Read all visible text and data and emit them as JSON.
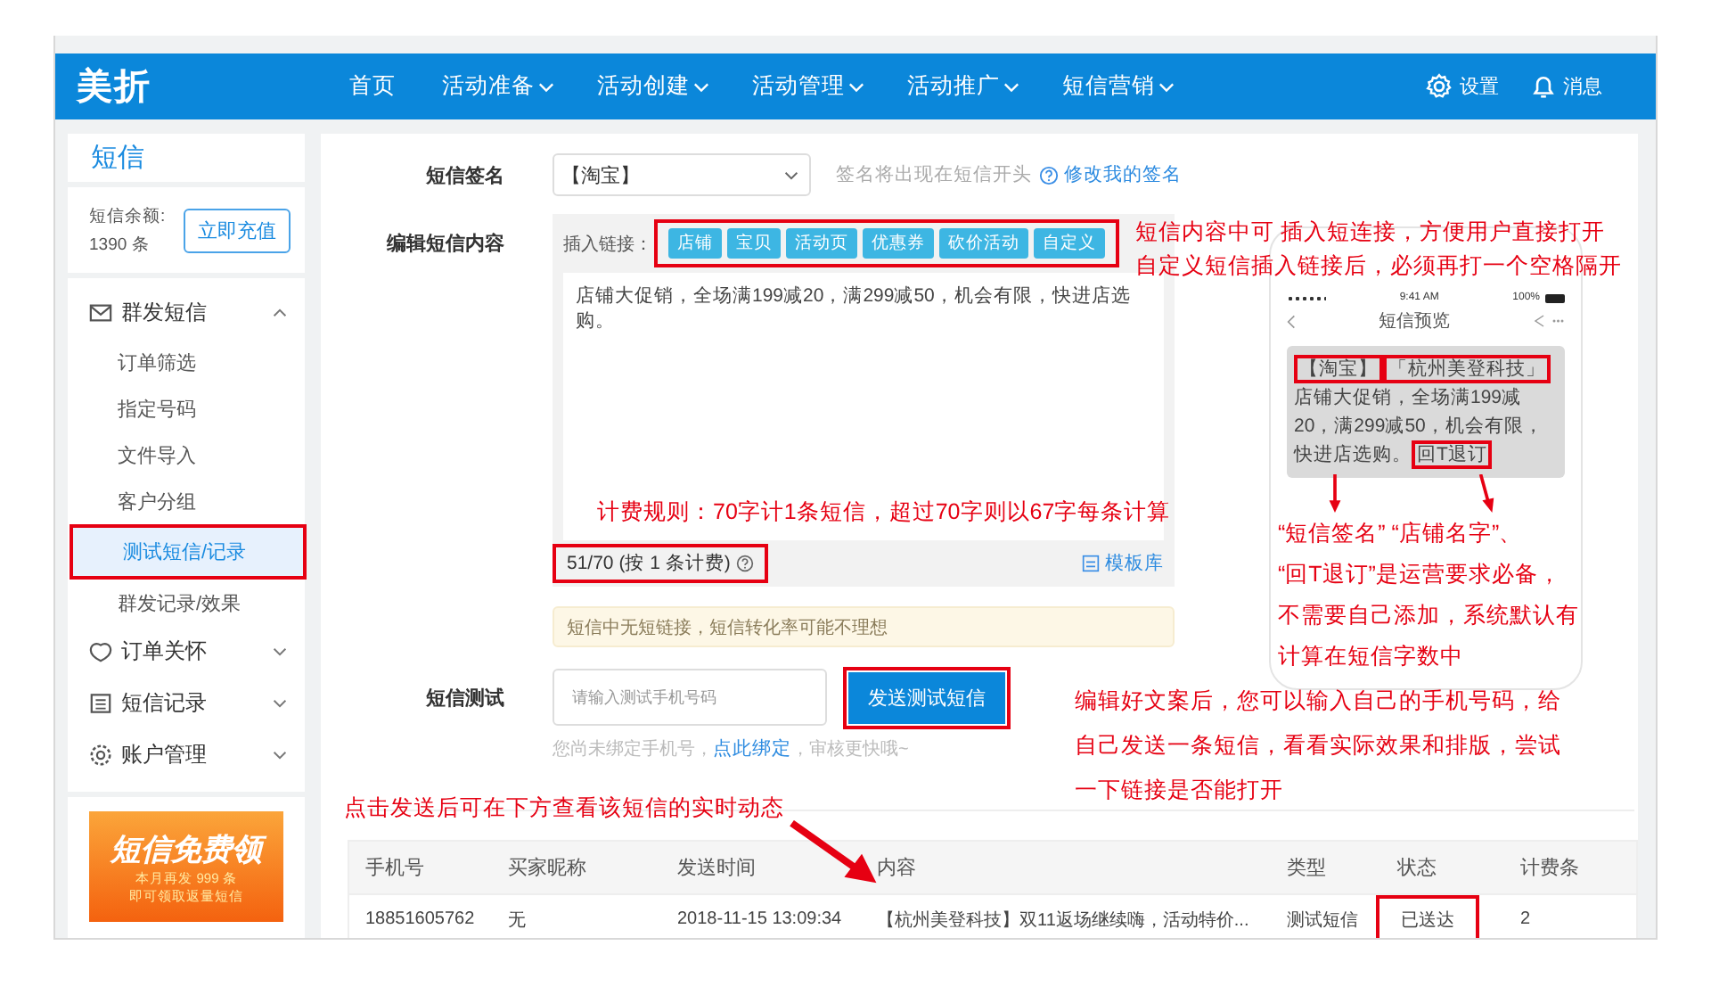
{
  "header": {
    "logo": "美折",
    "nav": [
      {
        "label": "首页",
        "has_menu": false
      },
      {
        "label": "活动准备",
        "has_menu": true
      },
      {
        "label": "活动创建",
        "has_menu": true
      },
      {
        "label": "活动管理",
        "has_menu": true
      },
      {
        "label": "活动推广",
        "has_menu": true
      },
      {
        "label": "短信营销",
        "has_menu": true
      }
    ],
    "settings": "设置",
    "messages": "消息"
  },
  "sidebar": {
    "title": "短信",
    "balance_label": "短信余额:",
    "balance_value": "1390 条",
    "recharge": "立即充值",
    "groups": [
      {
        "kind": "mail",
        "label": "群发短信",
        "expanded": true,
        "children": [
          {
            "label": "订单筛选",
            "selected": false
          },
          {
            "label": "指定号码",
            "selected": false
          },
          {
            "label": "文件导入",
            "selected": false
          },
          {
            "label": "客户分组",
            "selected": false
          },
          {
            "label": "测试短信/记录",
            "selected": true
          },
          {
            "label": "群发记录/效果",
            "selected": false
          }
        ]
      },
      {
        "kind": "care",
        "label": "订单关怀",
        "expanded": false
      },
      {
        "kind": "list",
        "label": "短信记录",
        "expanded": false
      },
      {
        "kind": "gear",
        "label": "账户管理",
        "expanded": false
      }
    ],
    "promo": {
      "title": "短信免费领",
      "line_1": "本月再发 999 条",
      "line_2": "即可领取返量短信"
    }
  },
  "form": {
    "signature": {
      "label": "短信签名",
      "value": "【淘宝】",
      "hint": "签名将出现在短信开头",
      "link": "修改我的签名"
    },
    "content": {
      "label": "编辑短信内容",
      "insert_label": "插入链接：",
      "link_buttons": [
        "店铺",
        "宝贝",
        "活动页",
        "优惠券",
        "砍价活动",
        "自定义"
      ],
      "text": "店铺大促销，全场满199减20，满299减50，机会有限，快进店选购。",
      "counter": "51/70 (按 1 条计费)",
      "template": "模板库",
      "warning": "短信中无短链接，短信转化率可能不理想"
    },
    "test": {
      "label": "短信测试",
      "placeholder": "请输入测试手机号码",
      "button": "发送测试短信",
      "hint_prefix": "您尚未绑定手机号，",
      "hint_link": "点此绑定",
      "hint_suffix": "，审核更快哦~"
    }
  },
  "preview": {
    "time": "9:41 AM",
    "battery": "100%",
    "title": "短信预览",
    "signature": "【淘宝】",
    "shop": "「杭州美登科技」",
    "body": "店铺大促销，全场满199减20，满299减50，机会有限，快进店选购。",
    "unsubscribe": "回T退订"
  },
  "table": {
    "columns": [
      "手机号",
      "买家昵称",
      "发送时间",
      "内容",
      "类型",
      "状态",
      "计费条"
    ],
    "rows": [
      {
        "cells": [
          "18851605762",
          "无",
          "2018-11-15 13:09:34",
          "【杭州美登科技】双11返场继续嗨，活动特价...",
          "测试短信",
          "已送达",
          "2"
        ]
      }
    ]
  },
  "annotations": [
    {
      "kind": "links",
      "lines": [
        "短信内容中可 插入短连接，方便用户直接打开",
        "自定义短信插入链接后，必须再打一个空格隔开"
      ]
    },
    {
      "kind": "billing",
      "lines": [
        "计费规则：70字计1条短信，超过70字则以67字每条计算"
      ]
    },
    {
      "kind": "preview",
      "lines": [
        "“短信签名” “店铺名字”、",
        "“回T退订”是运营要求必备，",
        "不需要自己添加，系统默认有",
        "计算在短信字数中"
      ]
    },
    {
      "kind": "test",
      "lines": [
        "编辑好文案后，您可以输入自己的手机号码，给",
        "自己发送一条短信，看看实际效果和排版，尝试",
        "一下链接是否能打开"
      ]
    },
    {
      "kind": "table",
      "lines": [
        "点击发送后可在下方查看该短信的实时动态"
      ]
    }
  ]
}
